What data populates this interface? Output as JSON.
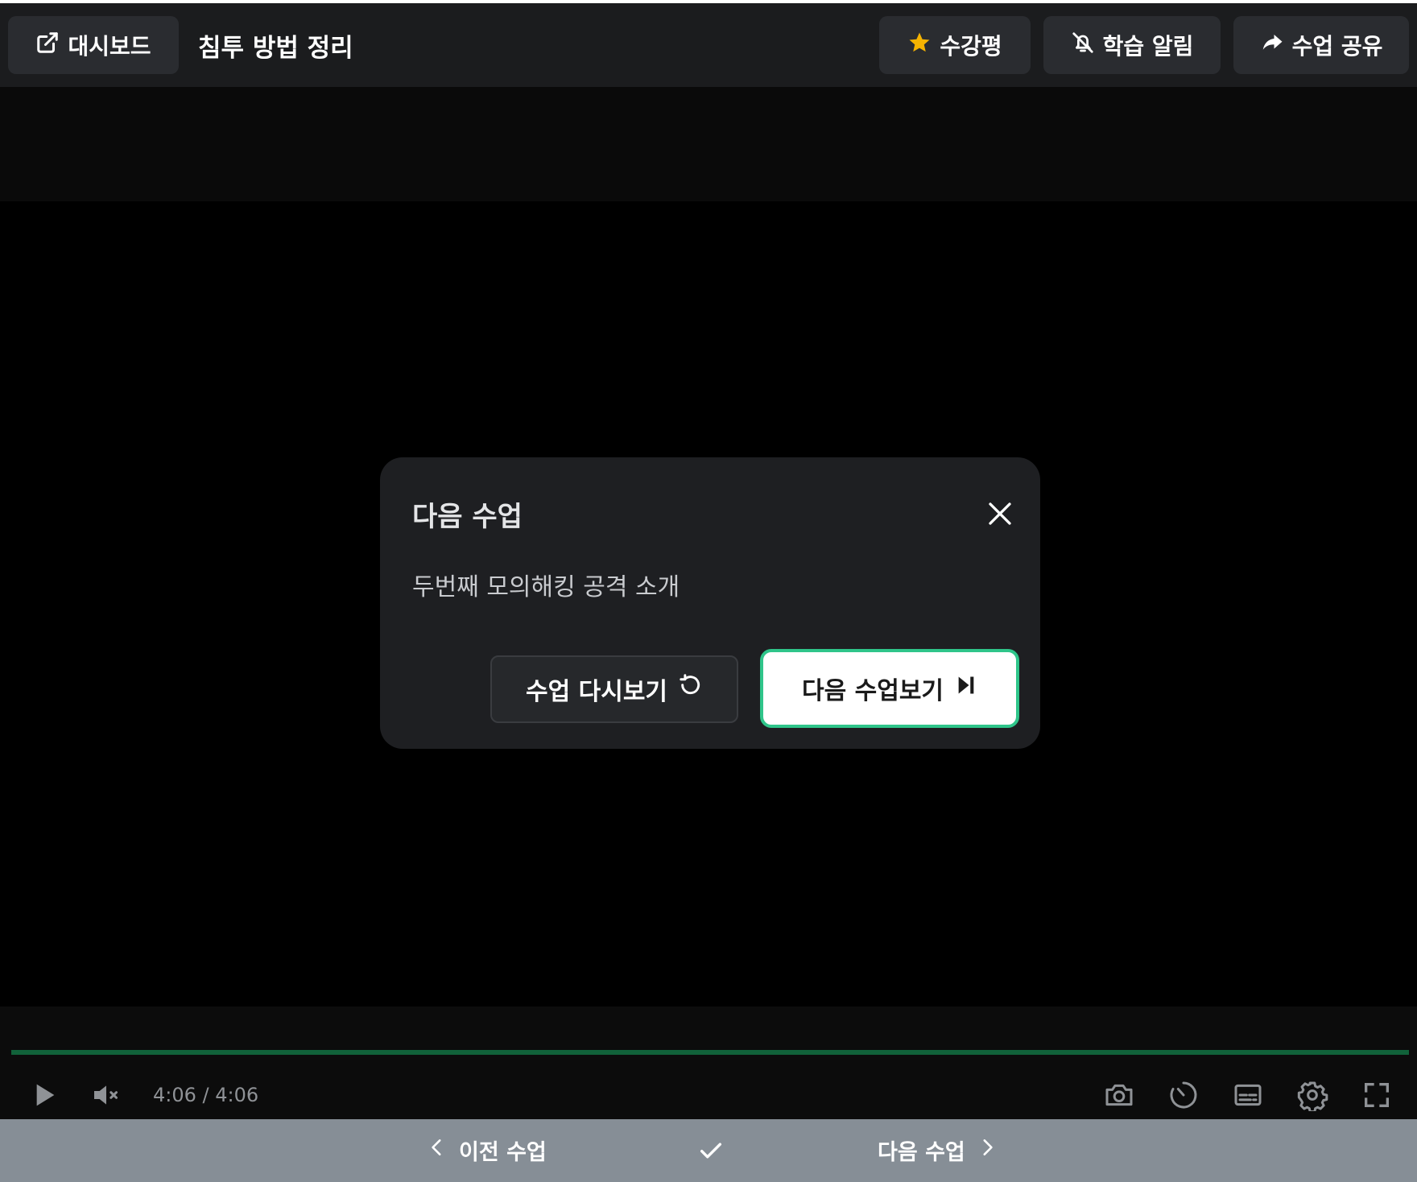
{
  "topbar": {
    "dashboard_label": "대시보드",
    "lecture_title": "침투 방법 정리",
    "review_label": "수강평",
    "notify_label": "학습 알림",
    "share_label": "수업 공유",
    "star_color": "#f5b301"
  },
  "modal": {
    "title": "다음 수업",
    "next_lesson_name": "두번째 모의해킹 공격 소개",
    "replay_label": "수업 다시보기",
    "next_label": "다음 수업보기",
    "accent_color": "#2fc58a"
  },
  "player": {
    "time": "4:06 / 4:06",
    "progress": 1.0,
    "muted": true
  },
  "bottom_nav": {
    "prev_label": "이전 수업",
    "next_label": "다음 수업"
  }
}
